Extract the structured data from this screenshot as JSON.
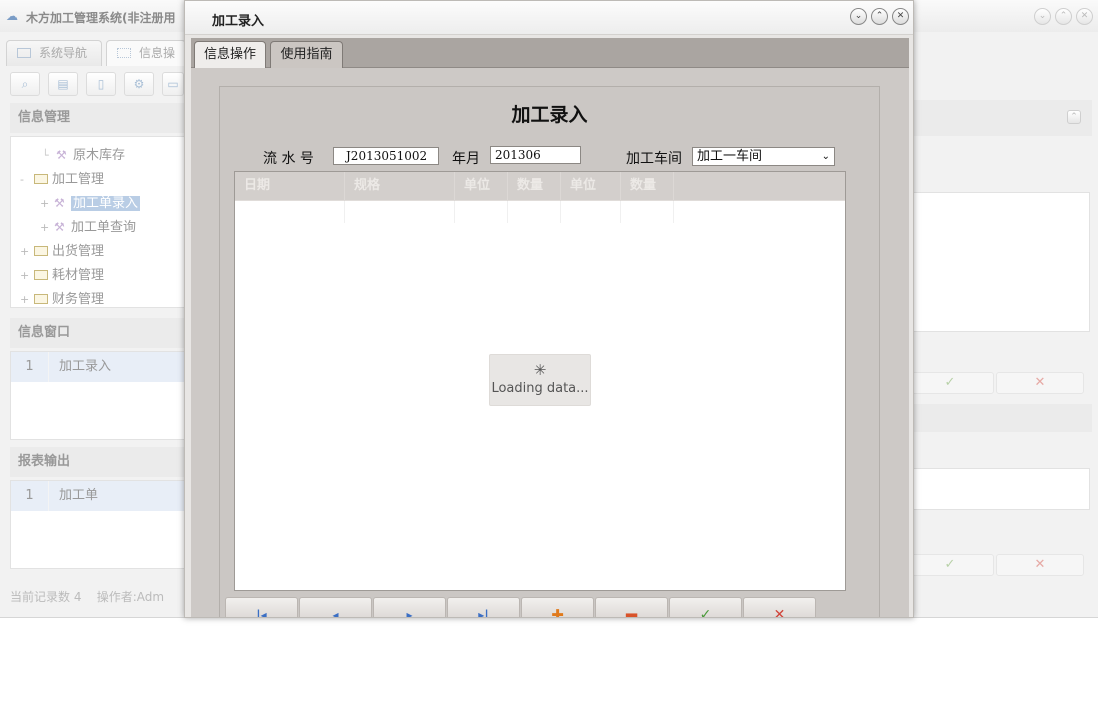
{
  "app": {
    "title": "木方加工管理系统(非注册用",
    "tabs": [
      "系统导航",
      "信息操"
    ],
    "panels": {
      "info_mgmt": {
        "title": "信息管理",
        "tree": [
          {
            "label": "原木库存"
          },
          {
            "label": "加工管理"
          },
          {
            "label": "加工单录入"
          },
          {
            "label": "加工单查询"
          },
          {
            "label": "出货管理"
          },
          {
            "label": "耗材管理"
          },
          {
            "label": "财务管理"
          }
        ]
      },
      "info_window": {
        "title": "信息窗口",
        "rows": [
          {
            "index": "1",
            "label": "加工录入"
          }
        ]
      },
      "report_output": {
        "title": "报表输出",
        "rows": [
          {
            "index": "1",
            "label": "加工单"
          }
        ]
      }
    },
    "status": {
      "record_count": "当前记录数 4",
      "operator": "操作者:Adm"
    }
  },
  "dialog": {
    "title": "加工录入",
    "tabs": {
      "info": "信息操作",
      "guide": "使用指南"
    },
    "form": {
      "title": "加工录入",
      "serial_label": "流 水 号",
      "serial_value": "J2013051002",
      "month_label": "年月",
      "month_value": "201306",
      "workshop_label": "加工车间",
      "workshop_value": "加工一车间"
    },
    "grid": {
      "columns": [
        "日期",
        "规格",
        "单位",
        "数量",
        "单位",
        "数量"
      ]
    },
    "loading_text": "Loading data..."
  },
  "icons": {
    "nav_first": "first-record-icon",
    "nav_prev": "prev-record-icon",
    "nav_next": "next-record-icon",
    "nav_last": "last-record-icon",
    "add": "plus-icon",
    "remove": "minus-icon",
    "confirm": "check-icon",
    "cancel": "close-icon"
  },
  "colors": {
    "nav_blue": "#3b6fc4",
    "add_orange": "#e07a1c",
    "remove_red": "#d9532a",
    "confirm_green": "#4a9a3a",
    "cancel_red": "#d0443a",
    "tree_selected": "#b9cde5"
  }
}
